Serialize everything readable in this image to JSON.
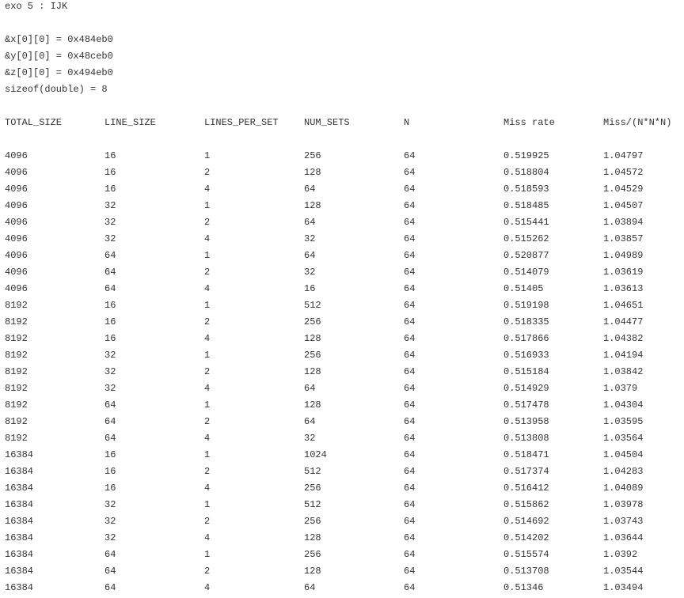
{
  "header": {
    "title": "exo 5 : IJK",
    "addr_x": "&x[0][0] = 0x484eb0",
    "addr_y": "&y[0][0] = 0x48ceb0",
    "addr_z": "&z[0][0] = 0x494eb0",
    "sizeof": "sizeof(double) = 8"
  },
  "table": {
    "columns": [
      "TOTAL_SIZE",
      "LINE_SIZE",
      "LINES_PER_SET",
      "NUM_SETS",
      "N",
      "Miss rate",
      "Miss/(N*N*N)"
    ],
    "rows": [
      [
        "4096",
        "16",
        "1",
        "256",
        "64",
        "0.519925",
        "1.04797"
      ],
      [
        "4096",
        "16",
        "2",
        "128",
        "64",
        "0.518804",
        "1.04572"
      ],
      [
        "4096",
        "16",
        "4",
        "64",
        "64",
        "0.518593",
        "1.04529"
      ],
      [
        "4096",
        "32",
        "1",
        "128",
        "64",
        "0.518485",
        "1.04507"
      ],
      [
        "4096",
        "32",
        "2",
        "64",
        "64",
        "0.515441",
        "1.03894"
      ],
      [
        "4096",
        "32",
        "4",
        "32",
        "64",
        "0.515262",
        "1.03857"
      ],
      [
        "4096",
        "64",
        "1",
        "64",
        "64",
        "0.520877",
        "1.04989"
      ],
      [
        "4096",
        "64",
        "2",
        "32",
        "64",
        "0.514079",
        "1.03619"
      ],
      [
        "4096",
        "64",
        "4",
        "16",
        "64",
        "0.51405",
        "1.03613"
      ],
      [
        "8192",
        "16",
        "1",
        "512",
        "64",
        "0.519198",
        "1.04651"
      ],
      [
        "8192",
        "16",
        "2",
        "256",
        "64",
        "0.518335",
        "1.04477"
      ],
      [
        "8192",
        "16",
        "4",
        "128",
        "64",
        "0.517866",
        "1.04382"
      ],
      [
        "8192",
        "32",
        "1",
        "256",
        "64",
        "0.516933",
        "1.04194"
      ],
      [
        "8192",
        "32",
        "2",
        "128",
        "64",
        "0.515184",
        "1.03842"
      ],
      [
        "8192",
        "32",
        "4",
        "64",
        "64",
        "0.514929",
        "1.0379"
      ],
      [
        "8192",
        "64",
        "1",
        "128",
        "64",
        "0.517478",
        "1.04304"
      ],
      [
        "8192",
        "64",
        "2",
        "64",
        "64",
        "0.513958",
        "1.03595"
      ],
      [
        "8192",
        "64",
        "4",
        "32",
        "64",
        "0.513808",
        "1.03564"
      ],
      [
        "16384",
        "16",
        "1",
        "1024",
        "64",
        "0.518471",
        "1.04504"
      ],
      [
        "16384",
        "16",
        "2",
        "512",
        "64",
        "0.517374",
        "1.04283"
      ],
      [
        "16384",
        "16",
        "4",
        "256",
        "64",
        "0.516412",
        "1.04089"
      ],
      [
        "16384",
        "32",
        "1",
        "512",
        "64",
        "0.515862",
        "1.03978"
      ],
      [
        "16384",
        "32",
        "2",
        "256",
        "64",
        "0.514692",
        "1.03743"
      ],
      [
        "16384",
        "32",
        "4",
        "128",
        "64",
        "0.514202",
        "1.03644"
      ],
      [
        "16384",
        "64",
        "1",
        "256",
        "64",
        "0.515574",
        "1.0392"
      ],
      [
        "16384",
        "64",
        "2",
        "128",
        "64",
        "0.513708",
        "1.03544"
      ],
      [
        "16384",
        "64",
        "4",
        "64",
        "64",
        "0.51346",
        "1.03494"
      ]
    ]
  }
}
